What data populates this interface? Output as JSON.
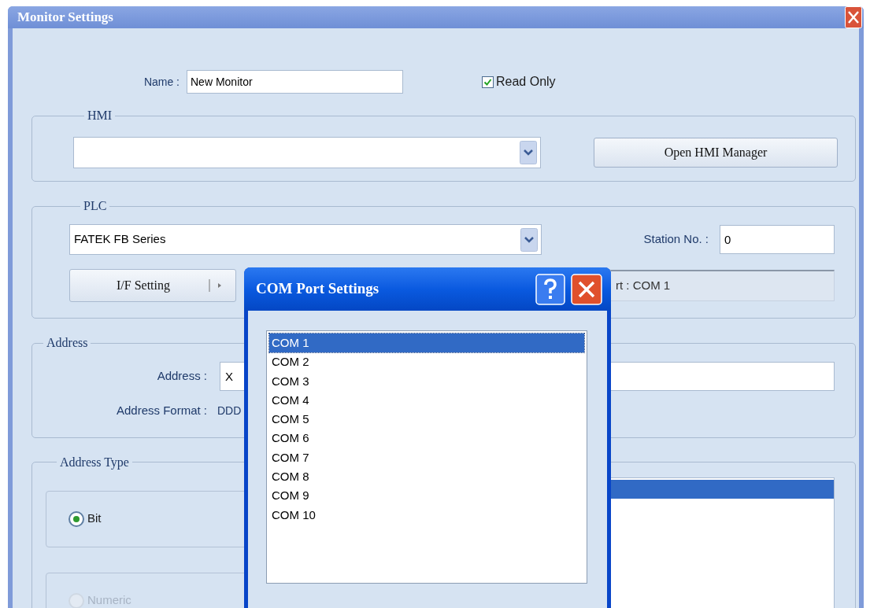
{
  "window": {
    "title": "Monitor Settings"
  },
  "name_row": {
    "label": "Name :",
    "value": "New Monitor",
    "read_only": {
      "label": "Read Only",
      "checked": true
    }
  },
  "hmi": {
    "legend": "HMI",
    "button": "Open HMI Manager"
  },
  "plc": {
    "legend": "PLC",
    "device": "FATEK FB Series",
    "station_label": "Station No. :",
    "station_value": "0",
    "if_button": "I/F Setting",
    "port_status": "rt : COM 1"
  },
  "address": {
    "legend": "Address",
    "label": "Address :",
    "value": "X",
    "format_label": "Address Format :",
    "format_value": "DDD"
  },
  "address_type": {
    "legend": "Address Type",
    "options": [
      {
        "label": "Bit",
        "selected": true,
        "disabled": false
      },
      {
        "label": "Numeric",
        "selected": false,
        "disabled": true
      }
    ],
    "list_rows": [
      {
        "selected": true
      }
    ]
  },
  "dialog": {
    "title": "COM Port Settings",
    "items": [
      {
        "label": "COM 1",
        "selected": true
      },
      {
        "label": "COM 2",
        "selected": false
      },
      {
        "label": "COM 3",
        "selected": false
      },
      {
        "label": "COM 4",
        "selected": false
      },
      {
        "label": "COM 5",
        "selected": false
      },
      {
        "label": "COM 6",
        "selected": false
      },
      {
        "label": "COM 7",
        "selected": false
      },
      {
        "label": "COM 8",
        "selected": false
      },
      {
        "label": "COM 9",
        "selected": false
      },
      {
        "label": "COM 10",
        "selected": false
      }
    ]
  }
}
